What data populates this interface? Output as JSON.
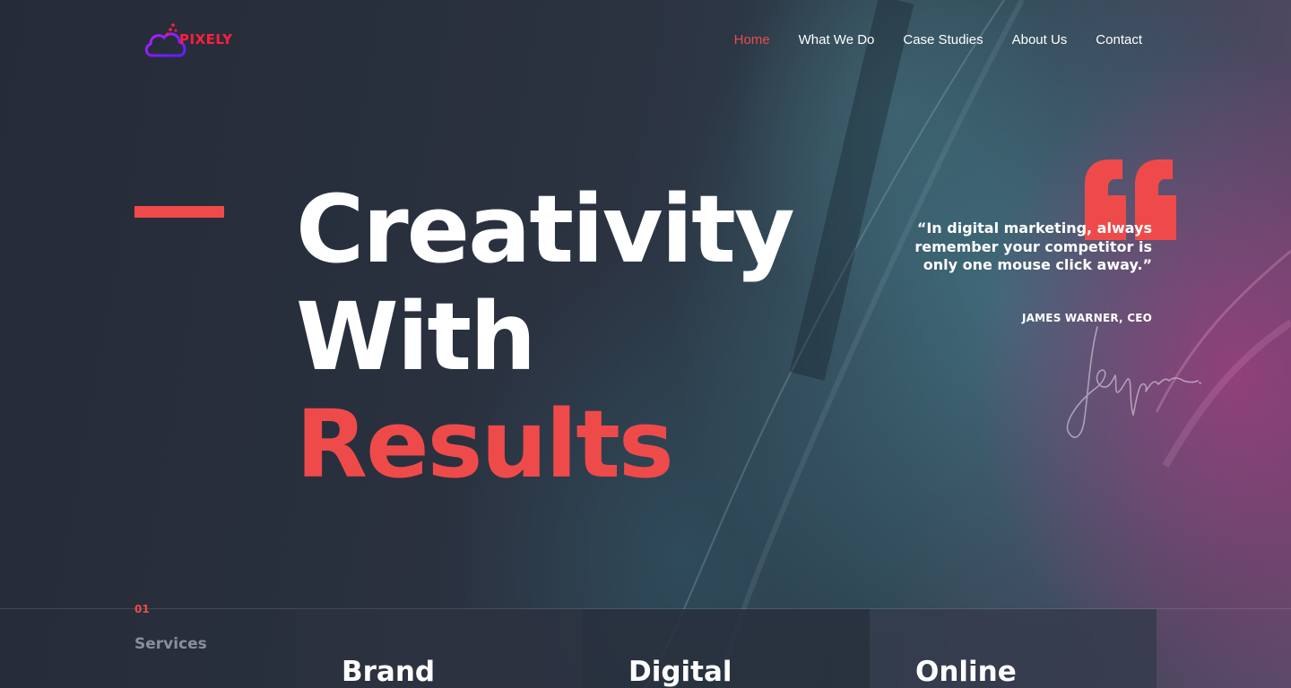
{
  "brand": {
    "name": "PIXELY",
    "logo_icon": "cloud-icon",
    "color": "#ff1f3d"
  },
  "nav": {
    "items": [
      {
        "label": "Home",
        "active": true
      },
      {
        "label": "What We Do",
        "active": false
      },
      {
        "label": "Case Studies",
        "active": false
      },
      {
        "label": "About Us",
        "active": false
      },
      {
        "label": "Contact",
        "active": false
      }
    ]
  },
  "hero": {
    "line1": "Creativity",
    "line2": "With",
    "line3": "Results",
    "accent_color": "#ef4a4a"
  },
  "quote": {
    "icon": "quote-icon",
    "text": "“In digital marketing, always remember your competitor is only one mouse click away.”",
    "author": "JAMES WARNER, CEO"
  },
  "services": {
    "number": "01",
    "label": "Services",
    "cards": [
      {
        "title": "Brand"
      },
      {
        "title": "Digital"
      },
      {
        "title": "Online"
      }
    ]
  }
}
